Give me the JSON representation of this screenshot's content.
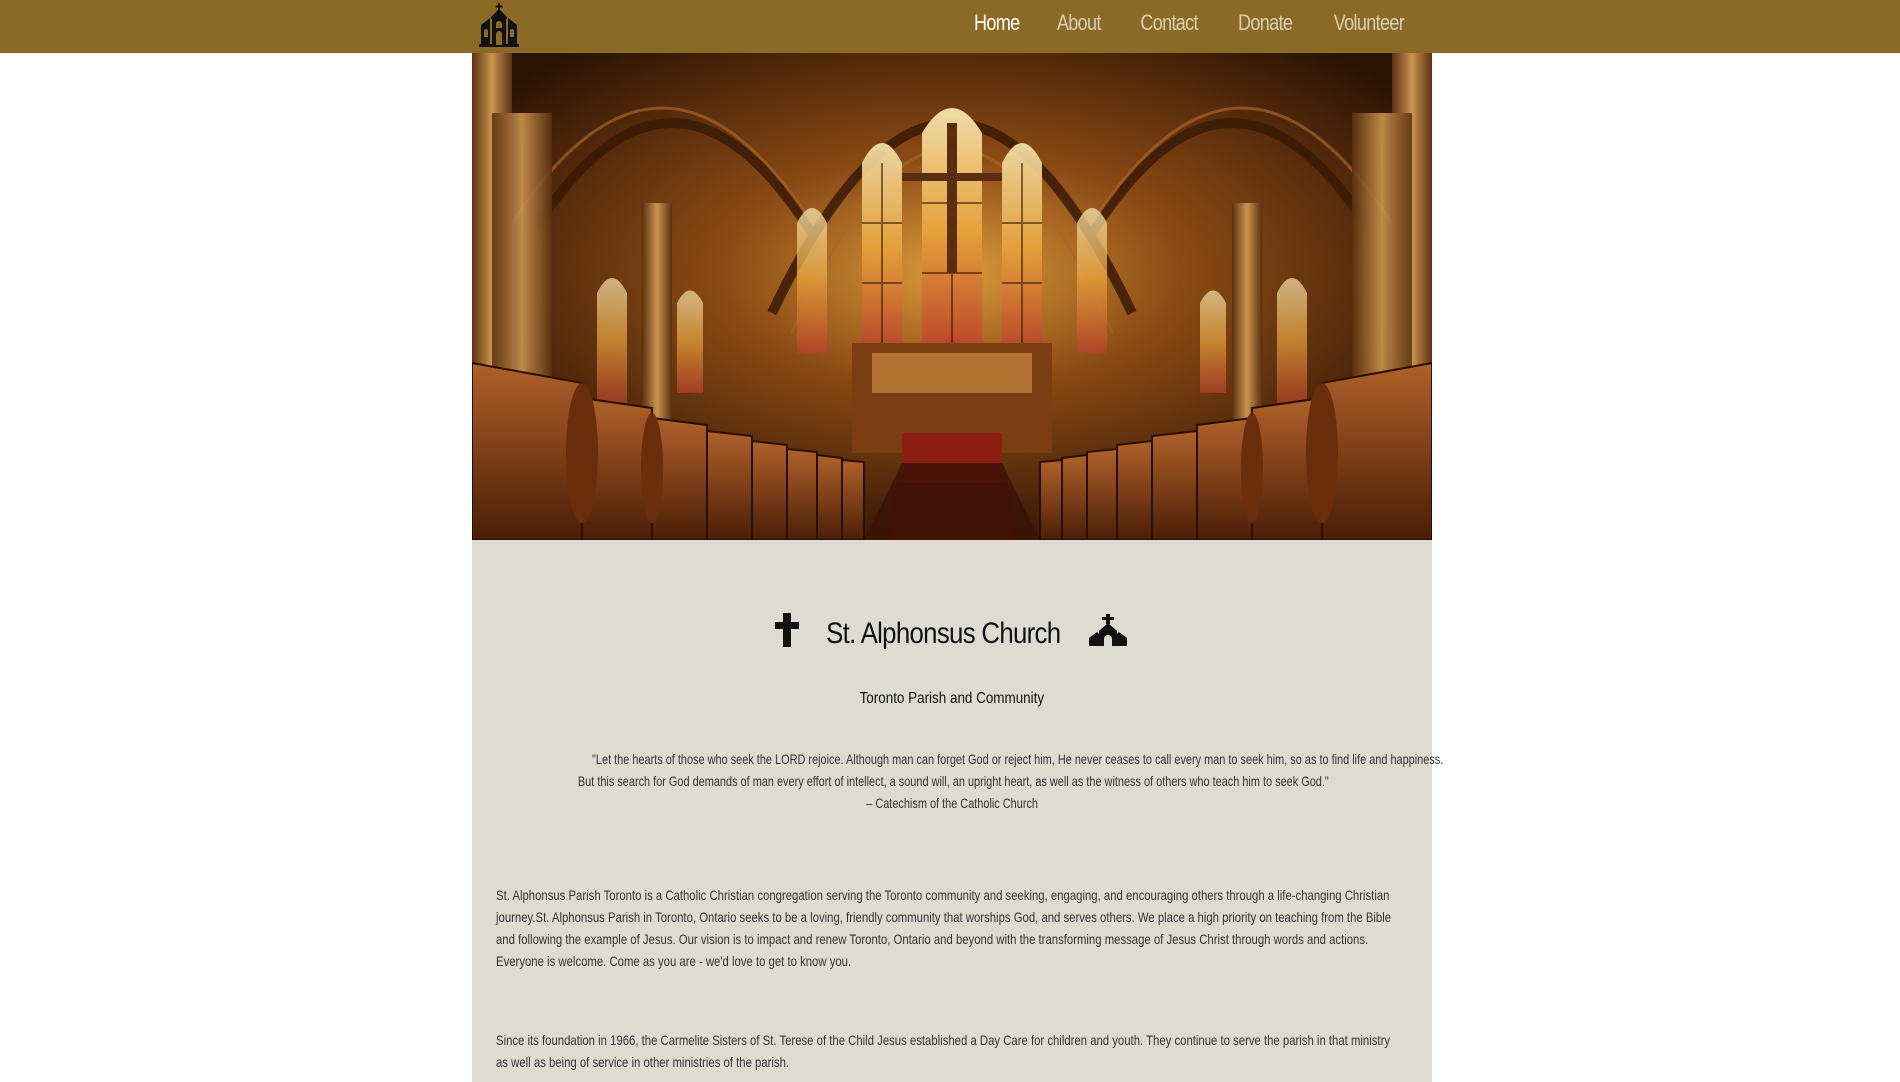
{
  "nav": {
    "logo_icon": "church-icon",
    "links": [
      {
        "label": "Home",
        "active": true
      },
      {
        "label": "About",
        "active": false
      },
      {
        "label": "Contact",
        "active": false
      },
      {
        "label": "Donate",
        "active": false
      },
      {
        "label": "Volunteer",
        "active": false
      }
    ]
  },
  "hero": {
    "image": "cathedral-interior-photo"
  },
  "main": {
    "title": "St. Alphonsus Church",
    "title_icons": [
      "cross-icon",
      "church-icon"
    ],
    "subtitle": "Toronto Parish and Community",
    "quote_lines": [
      "\"Let the hearts of those who seek the LORD rejoice. Although man can forget God or reject him, He never ceases to call every man to seek him, so as to find life and happiness.",
      "But this search for God demands of man every effort of intellect, a sound will, an upright heart, as well as the witness of others who teach him to seek God.\"",
      "– Catechism of the Catholic Church"
    ],
    "paragraph1": "St. Alphonsus Parish Toronto is a Catholic Christian congregation serving the Toronto community and seeking, engaging, and encouraging others through a life-changing Christian journey.St. Alphonsus Parish in Toronto, Ontario seeks to be a loving, friendly community that worships God, and serves others. We place a high priority on teaching from the Bible and following the example of Jesus. Our vision is to impact and renew Toronto, Ontario and beyond with the transforming message of Jesus Christ through words and actions. Everyone is welcome. Come as you are - we'd love to get to know you.",
    "paragraph2": "Since its foundation in 1966, the Carmelite Sisters of St. Terese of the Child Jesus established a Day Care for children and youth. They continue to serve the parish in that ministry as well as being of service in other ministries of the parish."
  },
  "colors": {
    "navbar": "#8b6a25",
    "content_bg": "#dedcd1",
    "nav_text": "#d9cfb4",
    "nav_active": "#ffffff"
  }
}
